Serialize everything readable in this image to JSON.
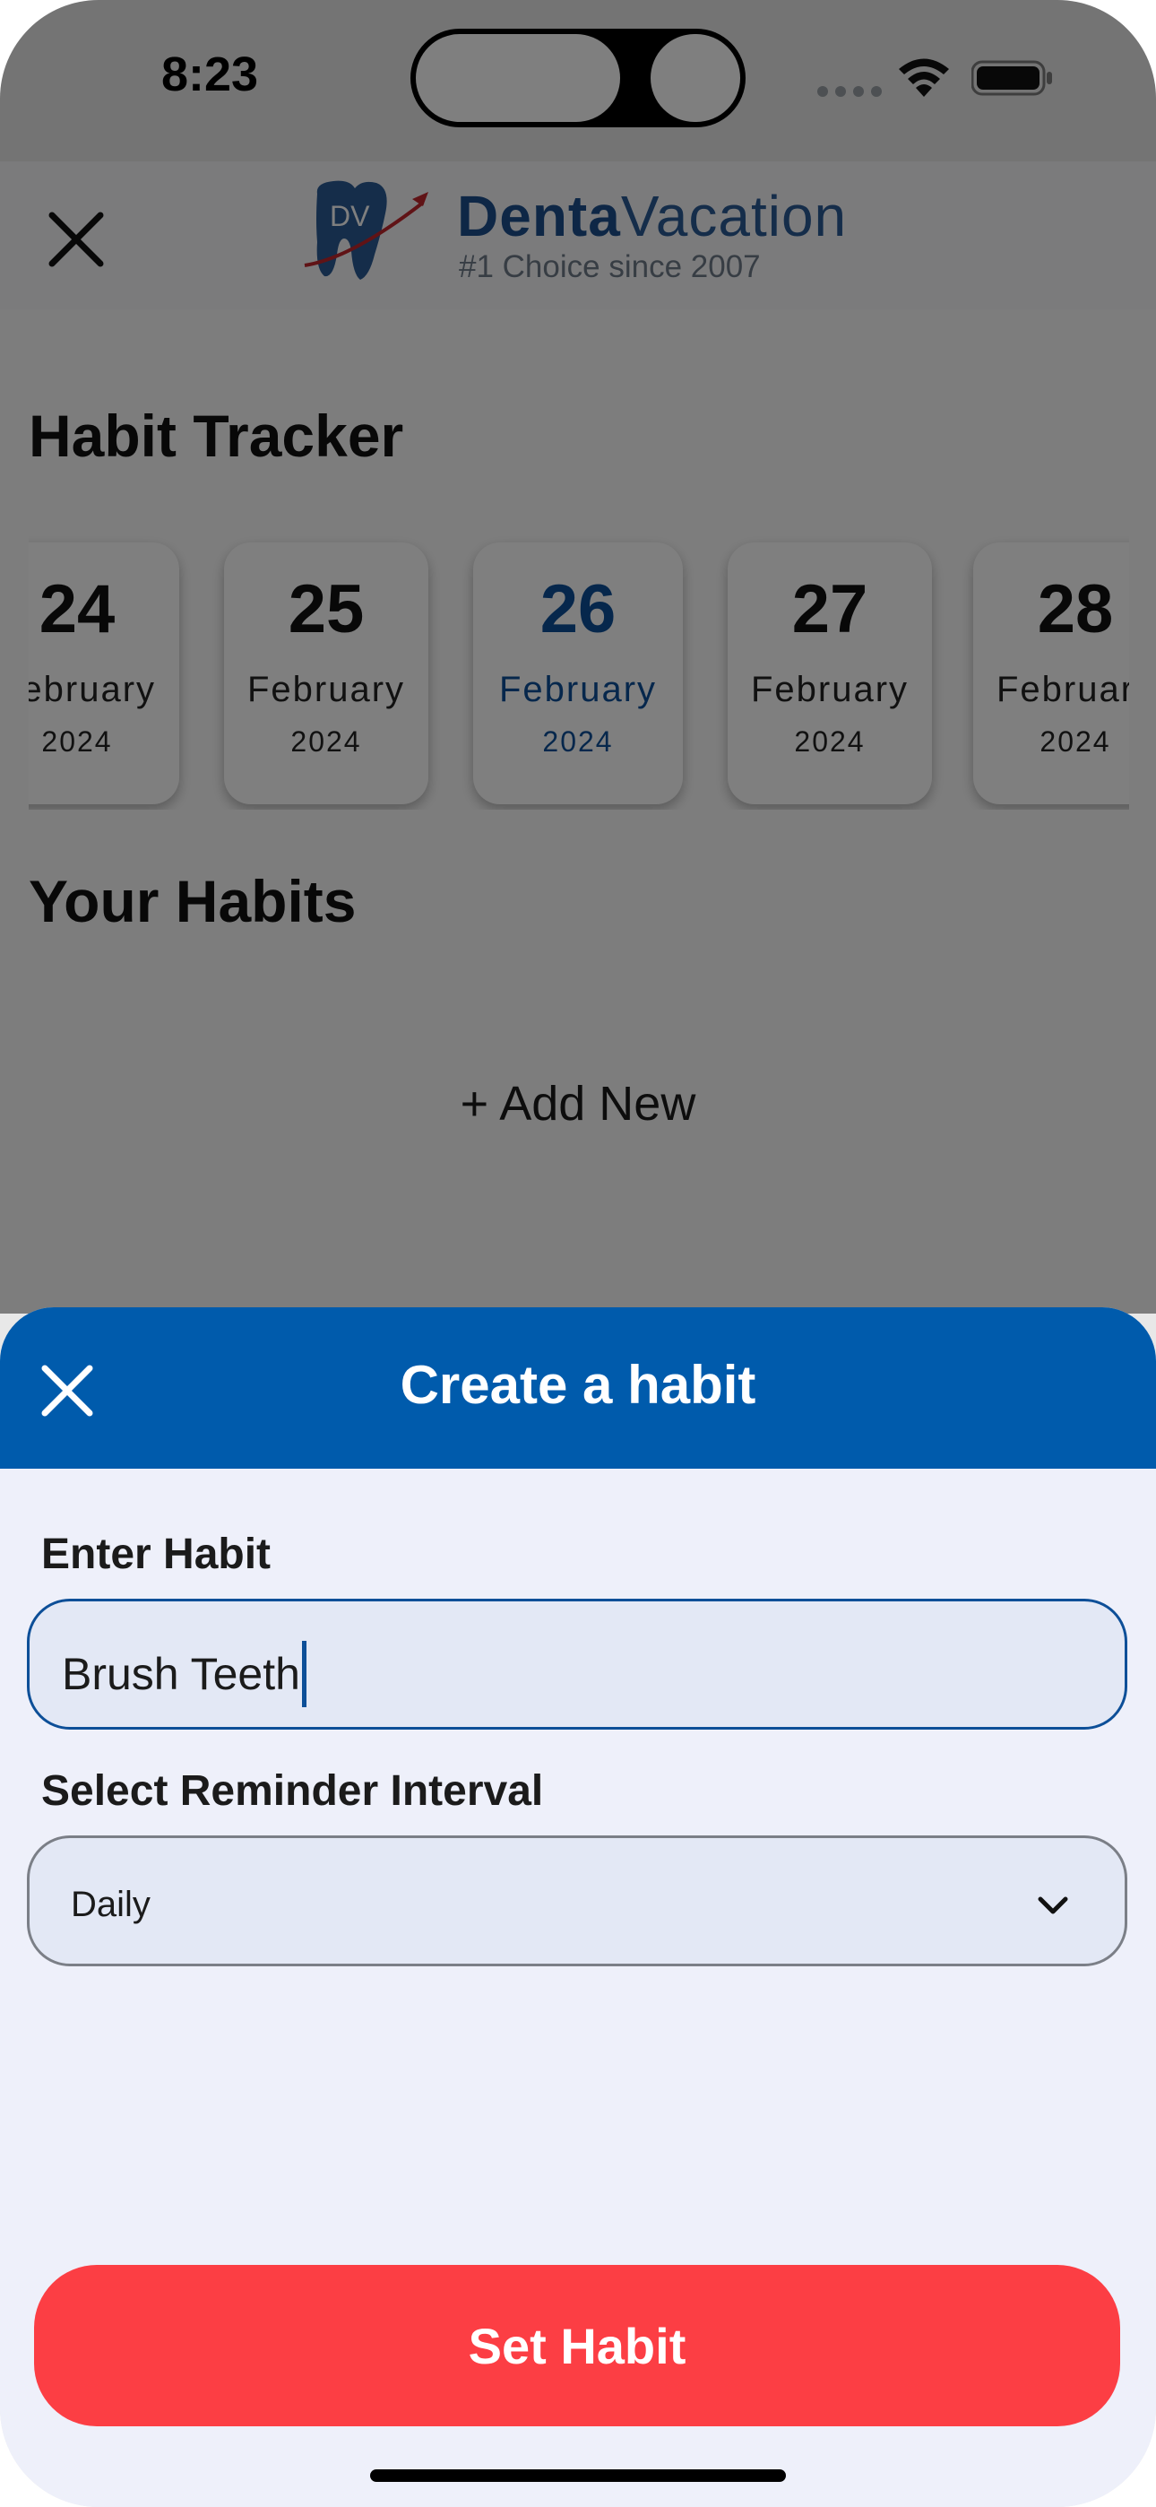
{
  "status_bar": {
    "time": "8:23"
  },
  "header": {
    "logo_initials": "DV",
    "brand_bold": "Denta",
    "brand_regular": "Vacation",
    "tagline": "#1 Choice since 2007"
  },
  "habit_tracker": {
    "title": "Habit Tracker",
    "dates": [
      {
        "day": "24",
        "month": "February",
        "year": "2024",
        "selected": false
      },
      {
        "day": "25",
        "month": "February",
        "year": "2024",
        "selected": false
      },
      {
        "day": "26",
        "month": "February",
        "year": "2024",
        "selected": true
      },
      {
        "day": "27",
        "month": "February",
        "year": "2024",
        "selected": false
      },
      {
        "day": "28",
        "month": "February",
        "year": "2024",
        "selected": false
      }
    ]
  },
  "habits": {
    "title": "Your Habits",
    "add_new_label": "+ Add New"
  },
  "sheet": {
    "title": "Create a habit",
    "enter_habit_label": "Enter Habit",
    "habit_value": "Brush Teeth",
    "interval_label": "Select Reminder Interval",
    "interval_value": "Daily",
    "set_button_label": "Set Habit"
  },
  "icons": [
    "close-icon",
    "chevron-down-icon",
    "wifi-icon",
    "battery-icon",
    "tooth-logo-icon"
  ],
  "colors": {
    "primary_blue": "#005bac",
    "accent_red": "#fc3e44",
    "sheet_bg": "#eef0fa"
  }
}
